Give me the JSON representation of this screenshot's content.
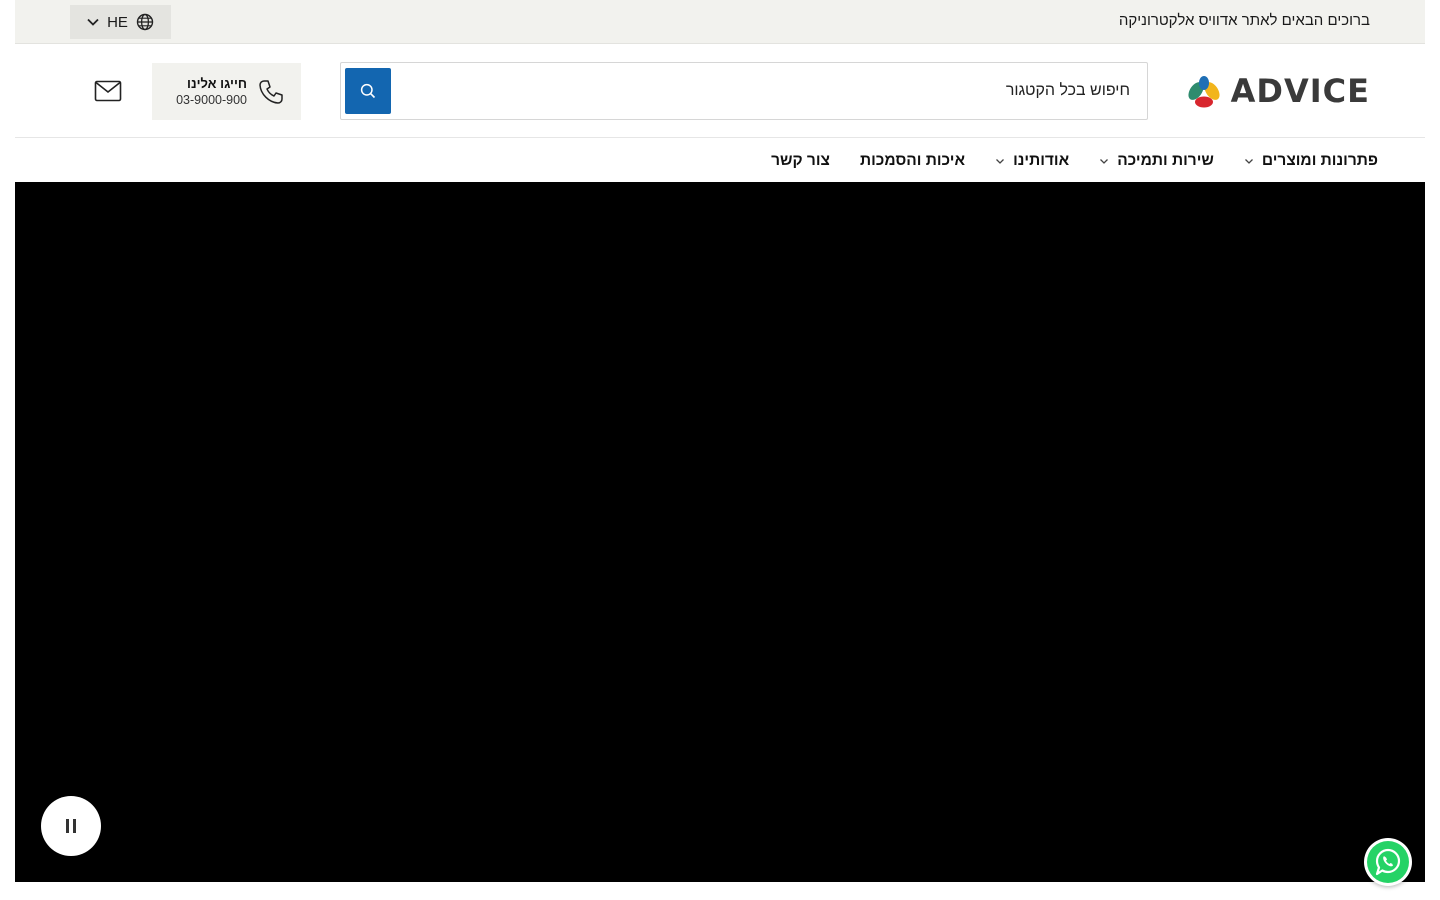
{
  "topbar": {
    "welcome_text": "ברוכים הבאים לאתר אדוויס אלקטרוניקה",
    "language_code": "HE"
  },
  "header": {
    "logo_text": "ADVICE",
    "search": {
      "placeholder": "חיפוש בכל הקטגור"
    },
    "contact": {
      "label": "חייגו אלינו",
      "phone": "03-9000-900"
    }
  },
  "nav": {
    "items": [
      {
        "label": "פתרונות ומוצרים",
        "has_dropdown": true
      },
      {
        "label": "שירות ותמיכה",
        "has_dropdown": true
      },
      {
        "label": "אודותינו",
        "has_dropdown": true
      },
      {
        "label": "איכות והסמכות",
        "has_dropdown": false
      },
      {
        "label": "צור קשר",
        "has_dropdown": false
      }
    ]
  },
  "hero": {
    "pause_icon": "pause-icon"
  },
  "colors": {
    "topbar_bg": "#f2f2ee",
    "accent_blue": "#1366b0",
    "hero_bg": "#000000",
    "whatsapp_green": "#25d366"
  },
  "icons": [
    "globe-icon",
    "chevron-down-icon",
    "search-icon",
    "phone-icon",
    "mail-icon",
    "pause-icon",
    "whatsapp-icon"
  ]
}
